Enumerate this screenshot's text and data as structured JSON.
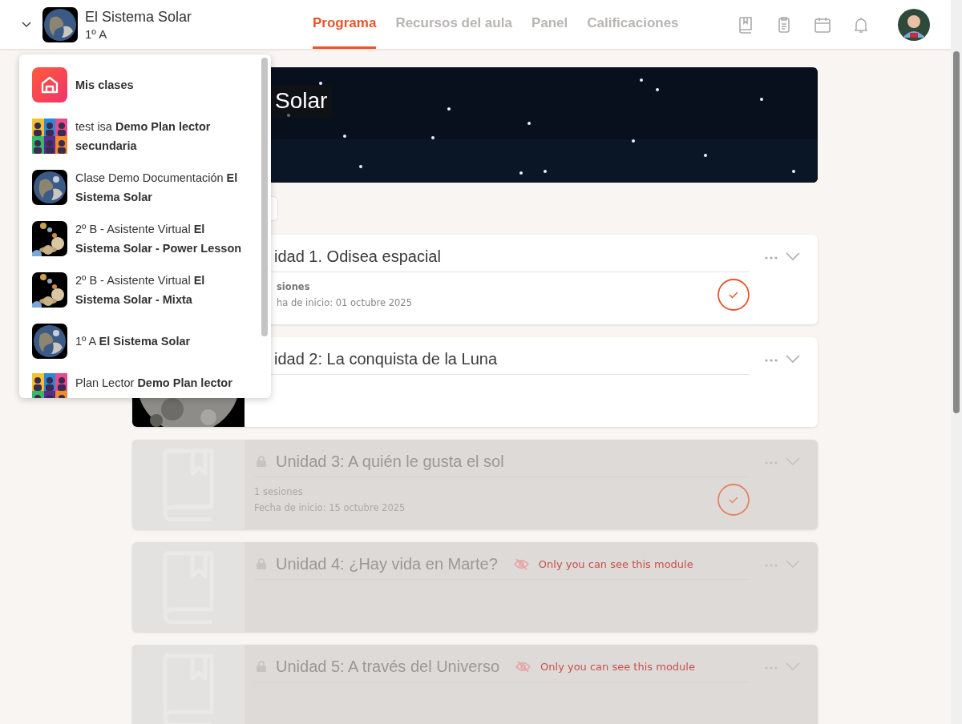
{
  "header": {
    "class_title": "El Sistema Solar",
    "class_group": "1º A",
    "tabs": [
      {
        "label": "Programa",
        "selected": true
      },
      {
        "label": "Recursos del aula",
        "selected": false
      },
      {
        "label": "Panel",
        "selected": false
      },
      {
        "label": "Calificaciones",
        "selected": false
      }
    ]
  },
  "class_menu": {
    "expanded": true,
    "items": [
      {
        "kind": "home",
        "label": "Mis clases"
      },
      {
        "kind": "picture",
        "label": "test isa **Demo Plan lector secundaria**"
      },
      {
        "kind": "picture",
        "label": "Clase Demo Documentación **El Sistema Solar**"
      },
      {
        "kind": "picture",
        "label": "2º B - Asistente Virtual **El Sistema Solar - Power Lesson**"
      },
      {
        "kind": "picture",
        "label": "2º B - Asistente Virtual **El Sistema Solar - Mixta**"
      },
      {
        "kind": "picture",
        "label": "1º A **El Sistema Solar**"
      },
      {
        "kind": "picture",
        "label": "Plan Lector **Demo Plan lector**"
      }
    ]
  },
  "banner": {
    "title": "Solar"
  },
  "units": [
    {
      "title": "idad 1. Odisea espacial",
      "locked": false,
      "sessions": "siones",
      "start_date": "ha de inicio: 01 octubre 2025",
      "done": true
    },
    {
      "title": "idad 2: La conquista de la Luna",
      "locked": false,
      "kind": "picture",
      "done": false
    },
    {
      "title": "Unidad 3: A quién le gusta el sol",
      "locked": true,
      "kind": "placeholder",
      "sessions": "1 sesiones",
      "start_date": "Fecha de inicio: 15 octubre 2025",
      "done": true
    },
    {
      "title": "Unidad 4: ¿Hay vida en Marte?",
      "locked": true,
      "kind": "placeholder",
      "note": "Only you can see this module",
      "done": false
    },
    {
      "title": "Unidad 5: A través del Universo",
      "locked": true,
      "kind": "placeholder",
      "note": "Only you can see this module",
      "done": false
    }
  ]
}
